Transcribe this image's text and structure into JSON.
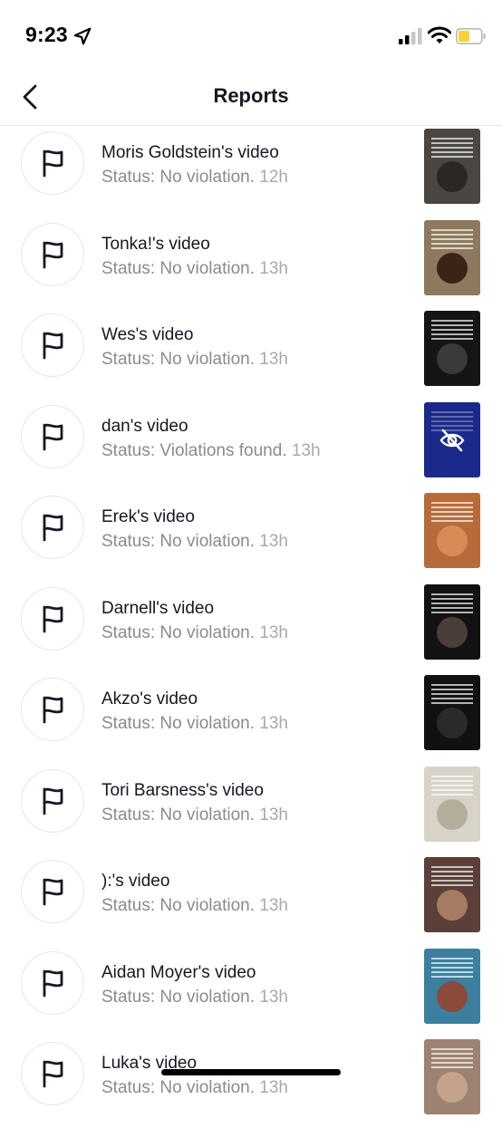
{
  "status_bar": {
    "time": "9:23",
    "battery_color": "#f5d237",
    "location_icon": "location-arrow-icon",
    "signal_icon": "cellular-signal-icon",
    "wifi_icon": "wifi-icon",
    "battery_icon": "battery-icon"
  },
  "header": {
    "title": "Reports",
    "back_icon": "chevron-left-icon"
  },
  "rows": [
    {
      "title": "Moris Goldstein's video",
      "status": "Status: No violation.",
      "time": "12h",
      "thumb_bg": "#4a4642",
      "thumb_fg": "#2a2724"
    },
    {
      "title": "Tonka!'s video",
      "status": "Status: No violation.",
      "time": "13h",
      "thumb_bg": "#8d7a5e",
      "thumb_fg": "#3a2418"
    },
    {
      "title": "Wes's video",
      "status": "Status: No violation.",
      "time": "13h",
      "thumb_bg": "#151515",
      "thumb_fg": "#3a3a3a"
    },
    {
      "title": "dan's video",
      "status": "Status: Violations found.",
      "time": "13h",
      "thumb_bg": "#1b2a8a",
      "thumb_fg": "#1b2a8a"
    },
    {
      "title": "Erek's video",
      "status": "Status: No violation.",
      "time": "13h",
      "thumb_bg": "#b86b3a",
      "thumb_fg": "#d98b55"
    },
    {
      "title": "Darnell's video",
      "status": "Status: No violation.",
      "time": "13h",
      "thumb_bg": "#121212",
      "thumb_fg": "#4b3d38"
    },
    {
      "title": "Akzo's video",
      "status": "Status: No violation.",
      "time": "13h",
      "thumb_bg": "#111111",
      "thumb_fg": "#2a2a2a"
    },
    {
      "title": "Tori Barsness's video",
      "status": "Status: No violation.",
      "time": "13h",
      "thumb_bg": "#d7d3c8",
      "thumb_fg": "#b4ad9c"
    },
    {
      "title": "):'s video",
      "status": "Status: No violation.",
      "time": "13h",
      "thumb_bg": "#5a4038",
      "thumb_fg": "#a77a62"
    },
    {
      "title": "Aidan Moyer's video",
      "status": "Status: No violation.",
      "time": "13h",
      "thumb_bg": "#3c7f9e",
      "thumb_fg": "#8a4b3a"
    },
    {
      "title": "Luka's video",
      "status": "Status: No violation.",
      "time": "13h",
      "thumb_bg": "#9c8270",
      "thumb_fg": "#c4a38a"
    }
  ],
  "row_icon": "flag-icon",
  "hidden_thumb_icon": "eye-slash-icon"
}
